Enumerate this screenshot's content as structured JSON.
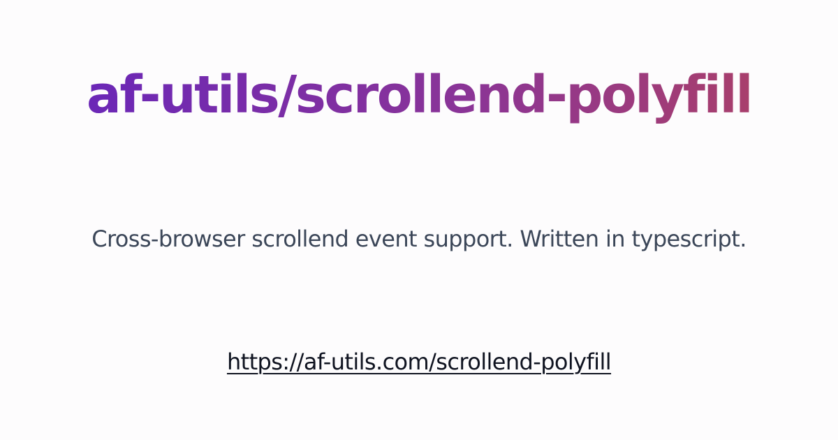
{
  "card": {
    "title": "af-utils/scrollend-polyfill",
    "description": "Cross-browser scrollend event support. Written in typescript.",
    "url": "https://af-utils.com/scrollend-polyfill"
  },
  "colors": {
    "background": "#fdfcfd",
    "title_gradient_start": "#6424be",
    "title_gradient_end": "#b1425f",
    "description_text": "#3b4658",
    "link_text": "#0f1320"
  }
}
